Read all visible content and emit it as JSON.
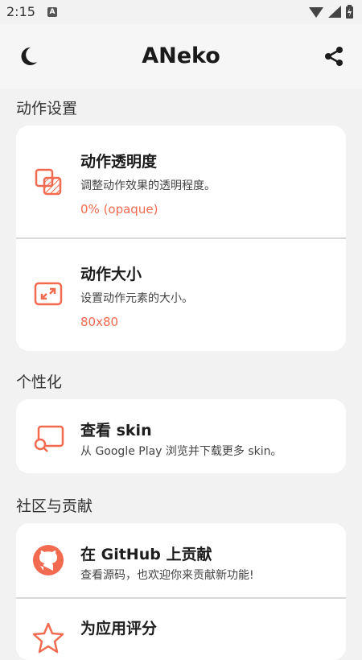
{
  "status_bar": {
    "time": "2:15",
    "notification_badge": "A"
  },
  "app_bar": {
    "title": "ANeko",
    "left_icon": "moon-icon",
    "right_icon": "share-icon"
  },
  "accent_color": "#f26a4f",
  "sections": {
    "action_settings": {
      "title": "动作设置",
      "opacity": {
        "title": "动作透明度",
        "description": "调整动作效果的透明程度。",
        "value": "0% (opaque)"
      },
      "size": {
        "title": "动作大小",
        "description": "设置动作元素的大小。",
        "value": "80x80"
      }
    },
    "personalization": {
      "title": "个性化",
      "skin": {
        "title": "查看 skin",
        "description": "从 Google Play 浏览并下载更多 skin。"
      }
    },
    "community": {
      "title": "社区与贡献",
      "github": {
        "title": "在 GitHub 上贡献",
        "description": "查看源码，也欢迎你来贡献新功能!"
      },
      "rate": {
        "title": "为应用评分"
      }
    }
  }
}
